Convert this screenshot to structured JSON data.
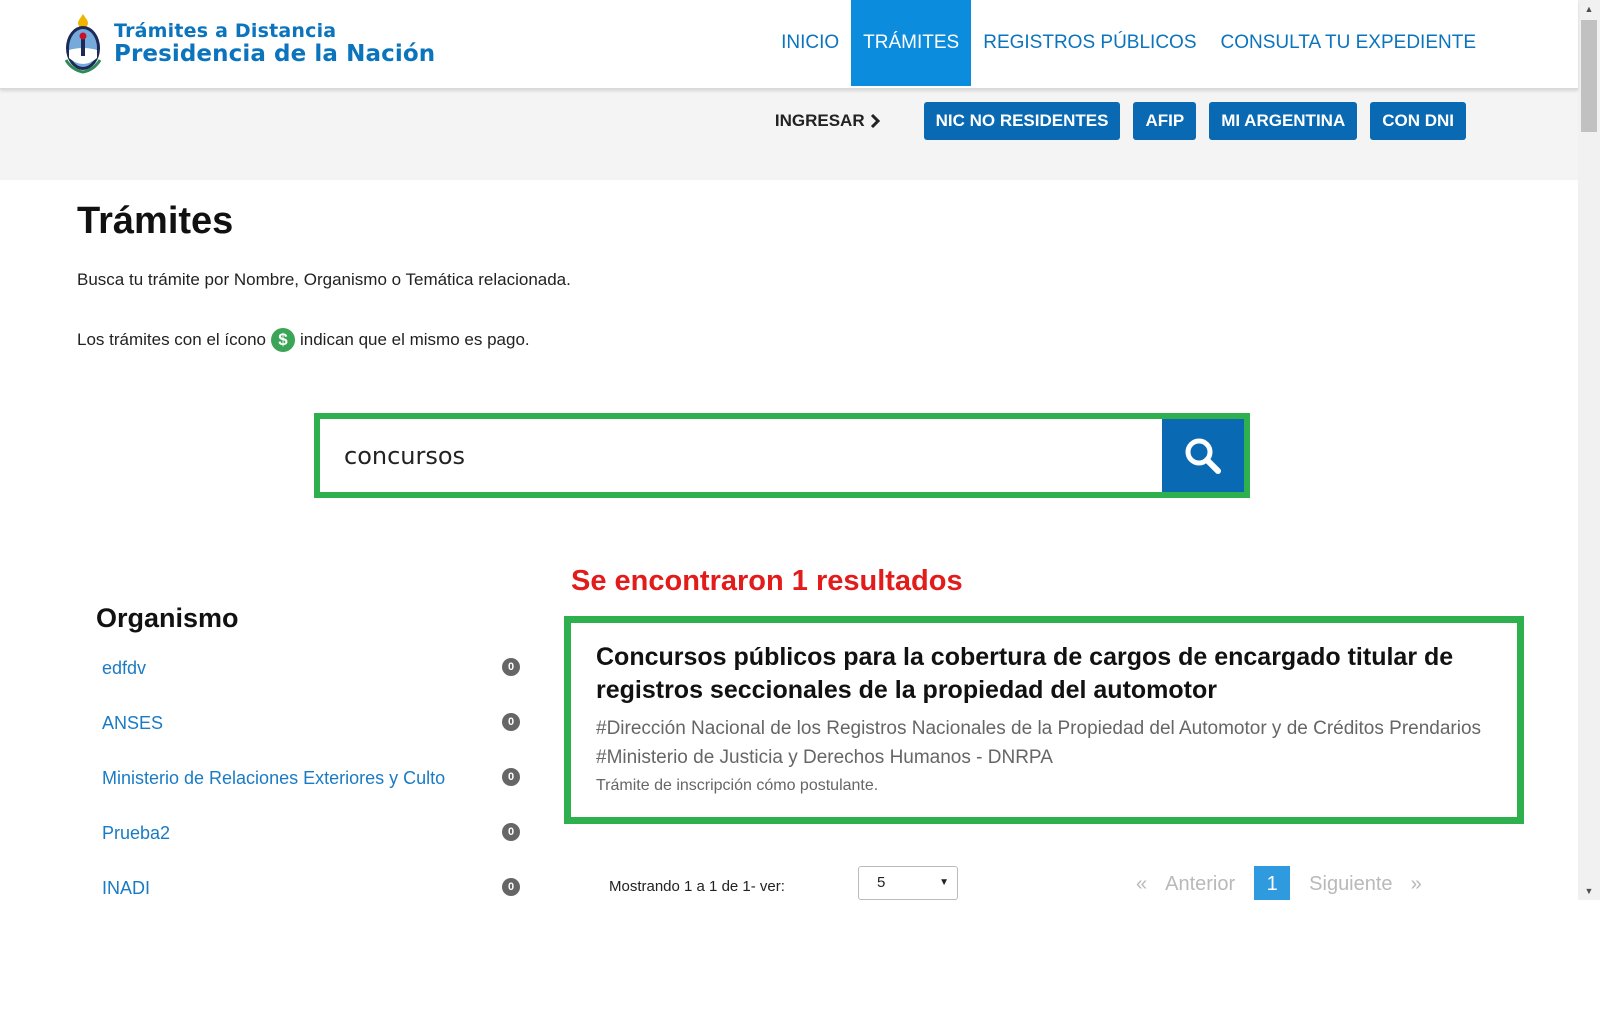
{
  "header": {
    "logo_line1": "Trámites a Distancia",
    "logo_line2": "Presidencia de la Nación",
    "nav": [
      {
        "label": "INICIO"
      },
      {
        "label": "TRÁMITES"
      },
      {
        "label": "REGISTROS PÚBLICOS"
      },
      {
        "label": "CONSULTA TU EXPEDIENTE"
      }
    ]
  },
  "login": {
    "label": "INGRESAR",
    "buttons": [
      "NIC NO RESIDENTES",
      "AFIP",
      "MI ARGENTINA",
      "CON DNI"
    ]
  },
  "main": {
    "title": "Trámites",
    "intro": "Busca tu trámite por Nombre, Organismo o Temática relacionada.",
    "pay_note_before": "Los trámites con el ícono",
    "pay_icon_symbol": "$",
    "pay_note_after": "indican que el mismo es pago."
  },
  "search": {
    "value": "concursos",
    "placeholder": ""
  },
  "sidebar": {
    "title": "Organismo",
    "items": [
      {
        "name": "edfdv",
        "count": "0"
      },
      {
        "name": "ANSES",
        "count": "0"
      },
      {
        "name": "Ministerio de Relaciones Exteriores y Culto",
        "count": "0"
      },
      {
        "name": "Prueba2",
        "count": "0"
      },
      {
        "name": "INADI",
        "count": "0"
      }
    ]
  },
  "results": {
    "count_text": "Se encontraron 1 resultados",
    "items": [
      {
        "title": "Concursos públicos para la cobertura de cargos de encargado titular de registros seccionales de la propiedad del automotor",
        "tags": "#Dirección Nacional de los Registros Nacionales de la Propiedad del Automotor y de Créditos Prendarios #Ministerio de Justicia y Derechos Humanos - DNRPA",
        "description": "Trámite de inscripción cómo postulante."
      }
    ]
  },
  "pagination": {
    "showing_text": "Mostrando 1 a 1 de 1- ver:",
    "per_page": "5",
    "prev_symbol": "«",
    "prev_label": "Anterior",
    "current_page": "1",
    "next_label": "Siguiente",
    "next_symbol": "»"
  },
  "colors": {
    "brand_blue": "#0969b3",
    "nav_active": "#0b8cdc",
    "highlight_green": "#2fb04e",
    "results_red": "#e21b1b"
  }
}
